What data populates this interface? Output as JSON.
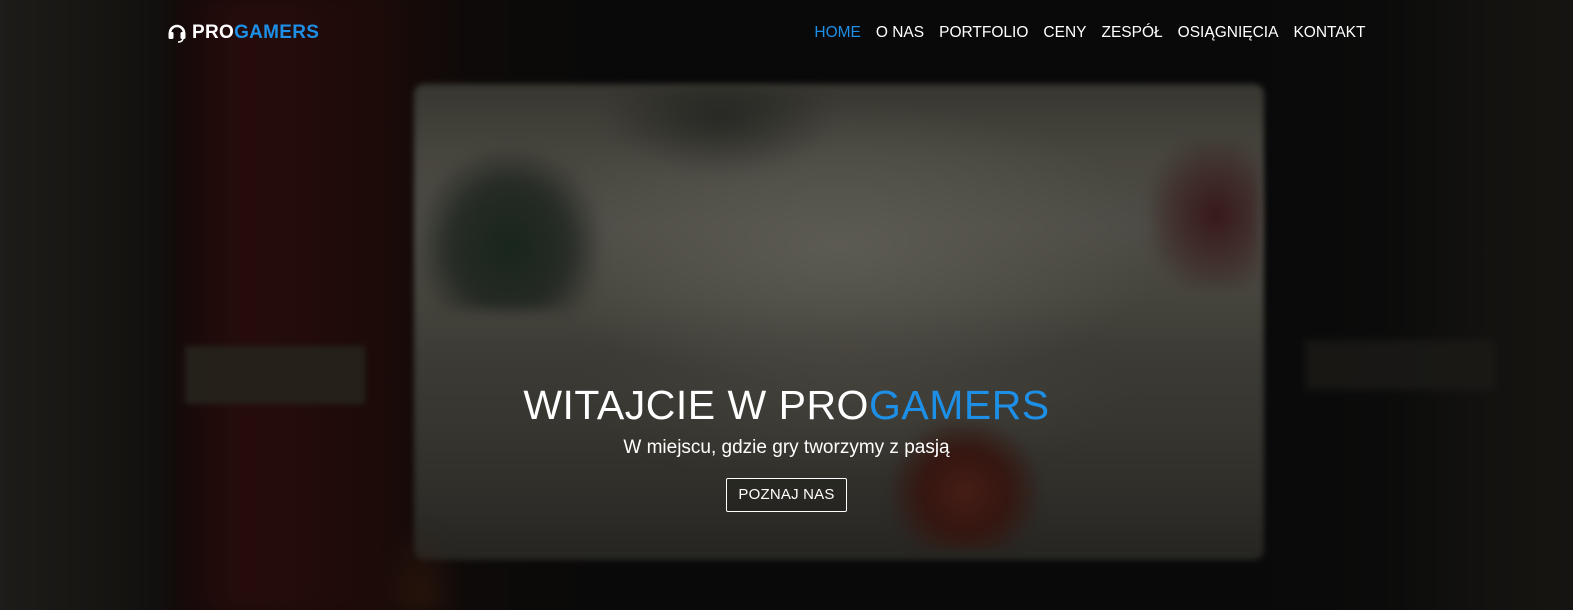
{
  "brand": {
    "logo_icon": "headset-icon",
    "name_part1": "PRO",
    "name_part2": "GAMERS",
    "accent_color": "#1d8fe6"
  },
  "nav": {
    "items": [
      {
        "label": "HOME",
        "active": true
      },
      {
        "label": "O NAS",
        "active": false
      },
      {
        "label": "PORTFOLIO",
        "active": false
      },
      {
        "label": "CENY",
        "active": false
      },
      {
        "label": "ZESPÓŁ",
        "active": false
      },
      {
        "label": "OSIĄGNIĘCIA",
        "active": false
      },
      {
        "label": "KONTAKT",
        "active": false
      }
    ]
  },
  "hero": {
    "title_part1": "WITAJCIE W PRO",
    "title_part2": "GAMERS",
    "subtitle": "W miejscu, gdzie gry tworzymy z pasją",
    "button_label": "POZNAJ NAS"
  }
}
